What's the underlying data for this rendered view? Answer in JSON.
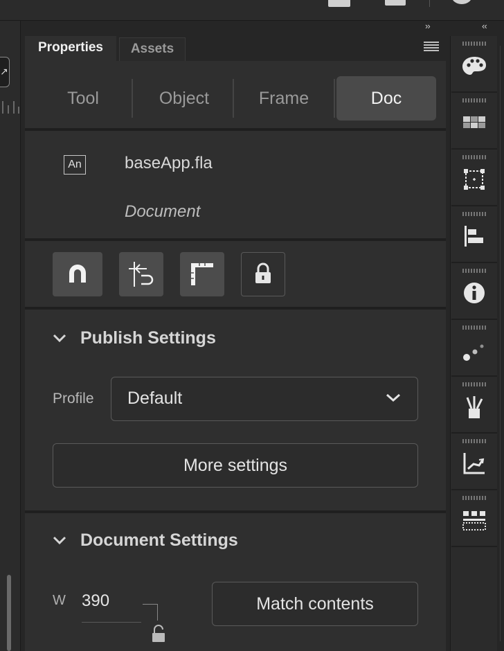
{
  "panel": {
    "collapse_right": "››",
    "collapse_left": "‹‹",
    "tabs": [
      {
        "label": "Properties",
        "active": true
      },
      {
        "label": "Assets",
        "active": false
      }
    ],
    "menu_icon": "hamburger-menu-icon"
  },
  "segments": [
    {
      "label": "Tool",
      "active": false
    },
    {
      "label": "Object",
      "active": false
    },
    {
      "label": "Frame",
      "active": false
    },
    {
      "label": "Doc",
      "active": true
    }
  ],
  "document": {
    "icon_text": "An",
    "file_name": "baseApp.fla",
    "type": "Document"
  },
  "doc_tools": [
    {
      "name": "snap-magnet-icon",
      "active": true
    },
    {
      "name": "edit-guides-icon",
      "active": true
    },
    {
      "name": "ruler-icon",
      "active": true
    },
    {
      "name": "lock-icon",
      "active": false
    }
  ],
  "publish": {
    "title": "Publish Settings",
    "profile_label": "Profile",
    "profile_value": "Default",
    "more_settings_label": "More settings"
  },
  "document_settings": {
    "title": "Document Settings",
    "width_label": "W",
    "width_value": "390",
    "match_contents_label": "Match contents"
  },
  "dock_icons": [
    "color-palette-icon",
    "swatches-icon",
    "transform-icon",
    "align-icon",
    "info-icon",
    "motion-presets-icon",
    "brush-library-icon",
    "motion-editor-icon",
    "components-icon"
  ],
  "colors": {
    "panel_bg": "#2f2f2f",
    "active_segment": "#4a4a4a",
    "active_tool": "#4c4c4c"
  }
}
